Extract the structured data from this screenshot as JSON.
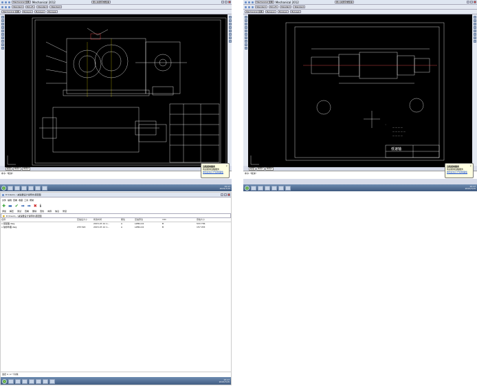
{
  "acad_left": {
    "title": "Mechanical 2012",
    "workspace": "Mechanical 经典",
    "style_combo": "Standard",
    "layer_combo": "ISO-25",
    "linetype": "ByLayer",
    "search_text": "键入关键字或短语",
    "tabs": [
      "模型",
      "布局1",
      "布局2"
    ],
    "command_line": "命令: *取消*"
  },
  "acad_right": {
    "title": "Mechanical 2012",
    "workspace": "Mechanical 经典",
    "style_combo": "Standard",
    "layer_combo": "ISO-25",
    "linetype": "ByLayer",
    "search_text": "键入关键字或短语",
    "tabs": [
      "模型",
      "布局1",
      "布局2"
    ],
    "command_line": "命令: *取消*",
    "titleblock_label": "低速轴"
  },
  "balloon": {
    "title": "远程控制服务",
    "body": "欢迎使用远程服务",
    "link": "单击此处打开控制面板"
  },
  "explorer": {
    "path": "D:\\Users\\...\\减速器设计说明书\\装配图",
    "menu": [
      "文件",
      "编辑",
      "查看",
      "收藏",
      "工具",
      "帮助"
    ],
    "toolbar": [
      "添加",
      "解压",
      "测试",
      "查看",
      "删除",
      "查找",
      "向导",
      "信息",
      "修复"
    ],
    "columns": [
      "名称",
      "压缩后大小",
      "修改时间",
      "属性",
      "压缩算法",
      "CRC",
      "原始大小"
    ],
    "rows": [
      {
        "name": "装配图.dwg",
        "packed": "",
        "modified": "2015-07-12 1...",
        "attr": "A",
        "method": "LZMA:24",
        "crc": "B",
        "size": "533 756"
      },
      {
        "name": "轴零件图.dwg",
        "packed": "235 520",
        "modified": "2015-07-12 1...",
        "attr": "A",
        "method": "LZMA:24",
        "crc": "B",
        "size": "157 053"
      }
    ],
    "status": "选定 0 / 2 个对象"
  },
  "clock": {
    "time": "15:17",
    "date": "2015/7/15"
  },
  "colors": {
    "canvas": "#000000",
    "taskbar": "#4a6790",
    "balloon": "#ffffe1"
  }
}
